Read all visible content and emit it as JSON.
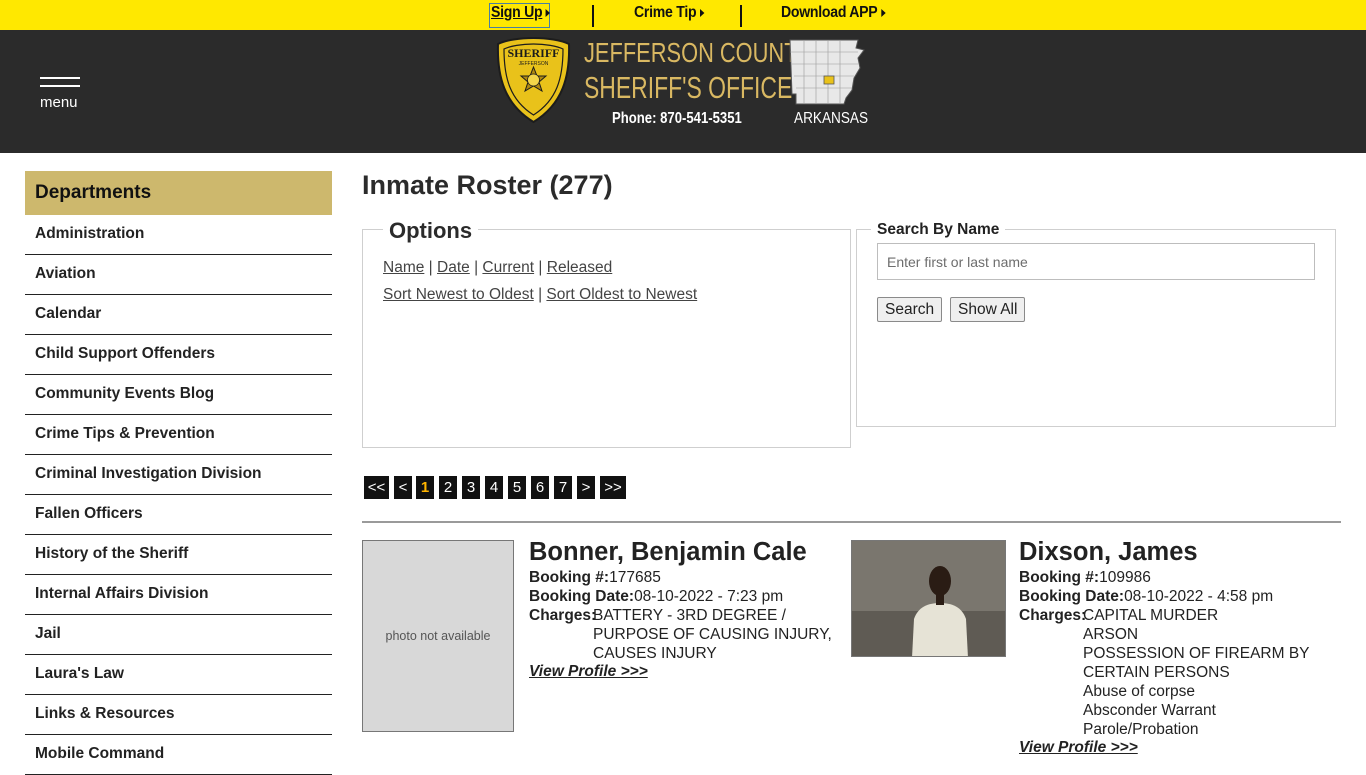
{
  "topbar": {
    "signup": "Sign Up",
    "crime_tip": "Crime Tip",
    "download_app": "Download APP"
  },
  "header": {
    "menu_label": "menu",
    "title_line1": "JEFFERSON COUNTY",
    "title_line2": "SHERIFF'S OFFICE",
    "phone": "Phone: 870-541-5351",
    "state": "ARKANSAS",
    "badge_text_top": "SHERIFF",
    "badge_text_sub": "JEFFERSON"
  },
  "sidebar": {
    "heading": "Departments",
    "items": [
      {
        "label": "Administration"
      },
      {
        "label": "Aviation"
      },
      {
        "label": "Calendar"
      },
      {
        "label": "Child Support Offenders"
      },
      {
        "label": "Community Events Blog"
      },
      {
        "label": "Crime Tips & Prevention"
      },
      {
        "label": "Criminal Investigation Division"
      },
      {
        "label": "Fallen Officers"
      },
      {
        "label": "History of the Sheriff"
      },
      {
        "label": "Internal Affairs Division"
      },
      {
        "label": "Jail"
      },
      {
        "label": "Laura's Law"
      },
      {
        "label": "Links & Resources"
      },
      {
        "label": "Mobile Command"
      }
    ]
  },
  "main": {
    "title": "Inmate Roster (277)",
    "options": {
      "legend": "Options",
      "name": "Name",
      "date": "Date",
      "current": "Current",
      "released": "Released",
      "sort_newest": "Sort Newest to Oldest",
      "sort_oldest": "Sort Oldest to Newest",
      "sep": "|"
    },
    "search": {
      "legend": "Search By Name",
      "placeholder": "Enter first or last name",
      "search_button": "Search",
      "show_all_button": "Show All"
    },
    "pager": {
      "first": "<<",
      "prev": "<",
      "pages": [
        "1",
        "2",
        "3",
        "4",
        "5",
        "6",
        "7"
      ],
      "current": "1",
      "next": ">",
      "last": ">>"
    }
  },
  "inmates": [
    {
      "name": "Bonner, Benjamin Cale",
      "booking_label": "Booking #:",
      "booking_no": "177685",
      "date_label": "Booking Date:",
      "booking_date": "08-10-2022 - 7:23 pm",
      "charges_label": "Charges:",
      "charges": [
        "BATTERY - 3RD DEGREE /",
        "PURPOSE OF CAUSING INJURY,",
        "CAUSES INJURY"
      ],
      "photo_text": "photo not available",
      "view_profile": "View Profile >>>"
    },
    {
      "name": "Dixson, James",
      "booking_label": "Booking #:",
      "booking_no": "109986",
      "date_label": "Booking Date:",
      "booking_date": "08-10-2022 - 4:58 pm",
      "charges_label": "Charges:",
      "charges": [
        "CAPITAL MURDER",
        "ARSON",
        "POSSESSION OF FIREARM BY",
        "CERTAIN PERSONS",
        "Abuse of corpse",
        "Absconder Warrant",
        "Parole/Probation"
      ],
      "view_profile": "View Profile >>>"
    }
  ],
  "colors": {
    "topbar": "#ffe800",
    "header": "#2b2b2b",
    "gold": "#d9b862",
    "dept_heading": "#cdb86d",
    "pager_active": "#ffb400"
  }
}
